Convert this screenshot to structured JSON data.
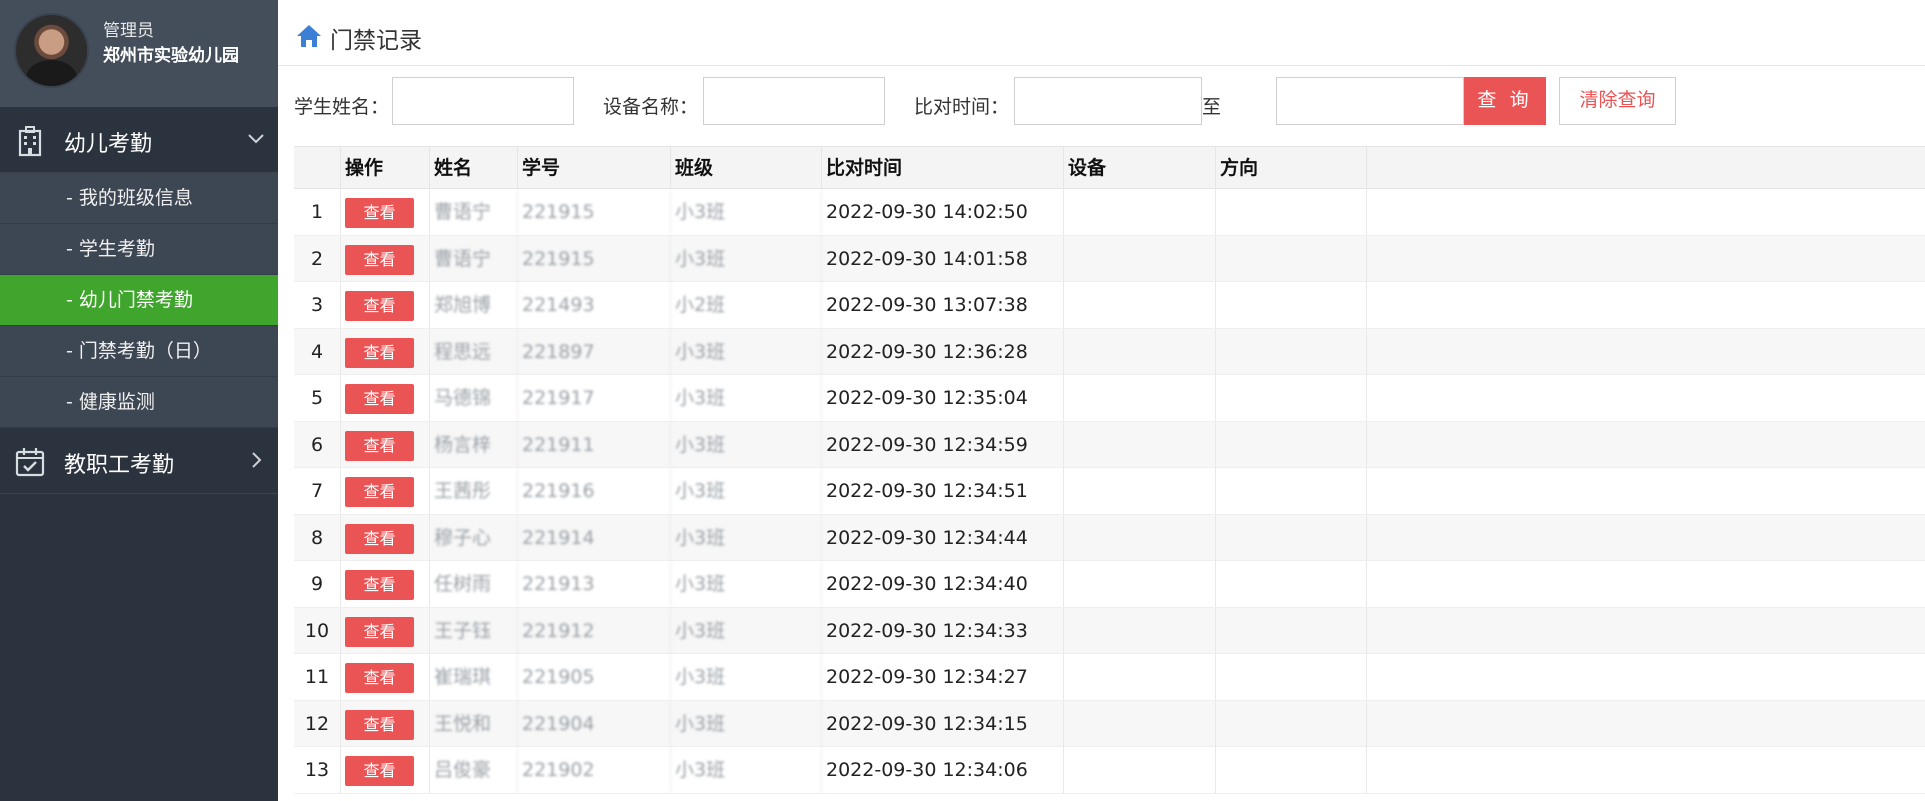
{
  "profile": {
    "role": "管理员",
    "org": "郑州市实验幼儿园"
  },
  "nav": {
    "group1": {
      "label": "幼儿考勤",
      "icon": "building-icon",
      "expanded": true
    },
    "sub_items": [
      {
        "label": "- 我的班级信息",
        "active": false
      },
      {
        "label": "- 学生考勤",
        "active": false
      },
      {
        "label": "- 幼儿门禁考勤",
        "active": true
      },
      {
        "label": "- 门禁考勤（日）",
        "active": false
      },
      {
        "label": "- 健康监测",
        "active": false
      }
    ],
    "group2": {
      "label": "教职工考勤",
      "icon": "calendar-check-icon",
      "expanded": false
    }
  },
  "page": {
    "title": "门禁记录"
  },
  "filters": {
    "student_name_label": "学生姓名：",
    "student_name_value": "",
    "device_name_label": "设备名称：",
    "device_name_value": "",
    "time_label": "比对时间：",
    "time_from": "",
    "to_label": "至",
    "time_to": "",
    "query_button": "查 询",
    "clear_button": "清除查询"
  },
  "table": {
    "headers": [
      "操作",
      "姓名",
      "学号",
      "班级",
      "比对时间",
      "设备",
      "方向"
    ],
    "action_label": "查看",
    "rows": [
      {
        "no": "1",
        "name": "曹语宁",
        "id": "221915",
        "cls": "小3班",
        "time": "2022-09-30 14:02:50",
        "device": "",
        "direction": ""
      },
      {
        "no": "2",
        "name": "曹语宁",
        "id": "221915",
        "cls": "小3班",
        "time": "2022-09-30 14:01:58",
        "device": "",
        "direction": ""
      },
      {
        "no": "3",
        "name": "郑旭博",
        "id": "221493",
        "cls": "小2班",
        "time": "2022-09-30 13:07:38",
        "device": "",
        "direction": ""
      },
      {
        "no": "4",
        "name": "程思远",
        "id": "221897",
        "cls": "小3班",
        "time": "2022-09-30 12:36:28",
        "device": "",
        "direction": ""
      },
      {
        "no": "5",
        "name": "马德锦",
        "id": "221917",
        "cls": "小3班",
        "time": "2022-09-30 12:35:04",
        "device": "",
        "direction": ""
      },
      {
        "no": "6",
        "name": "杨言梓",
        "id": "221911",
        "cls": "小3班",
        "time": "2022-09-30 12:34:59",
        "device": "",
        "direction": ""
      },
      {
        "no": "7",
        "name": "王茜彤",
        "id": "221916",
        "cls": "小3班",
        "time": "2022-09-30 12:34:51",
        "device": "",
        "direction": ""
      },
      {
        "no": "8",
        "name": "穆子心",
        "id": "221914",
        "cls": "小3班",
        "time": "2022-09-30 12:34:44",
        "device": "",
        "direction": ""
      },
      {
        "no": "9",
        "name": "任树雨",
        "id": "221913",
        "cls": "小3班",
        "time": "2022-09-30 12:34:40",
        "device": "",
        "direction": ""
      },
      {
        "no": "10",
        "name": "王子钰",
        "id": "221912",
        "cls": "小3班",
        "time": "2022-09-30 12:34:33",
        "device": "",
        "direction": ""
      },
      {
        "no": "11",
        "name": "崔瑞琪",
        "id": "221905",
        "cls": "小3班",
        "time": "2022-09-30 12:34:27",
        "device": "",
        "direction": ""
      },
      {
        "no": "12",
        "name": "王悦和",
        "id": "221904",
        "cls": "小3班",
        "time": "2022-09-30 12:34:15",
        "device": "",
        "direction": ""
      },
      {
        "no": "13",
        "name": "吕俊豪",
        "id": "221902",
        "cls": "小3班",
        "time": "2022-09-30 12:34:06",
        "device": "",
        "direction": ""
      }
    ]
  },
  "colors": {
    "sidebar": "#2b333e",
    "active": "#3fa52c",
    "accent": "#ea5455"
  }
}
